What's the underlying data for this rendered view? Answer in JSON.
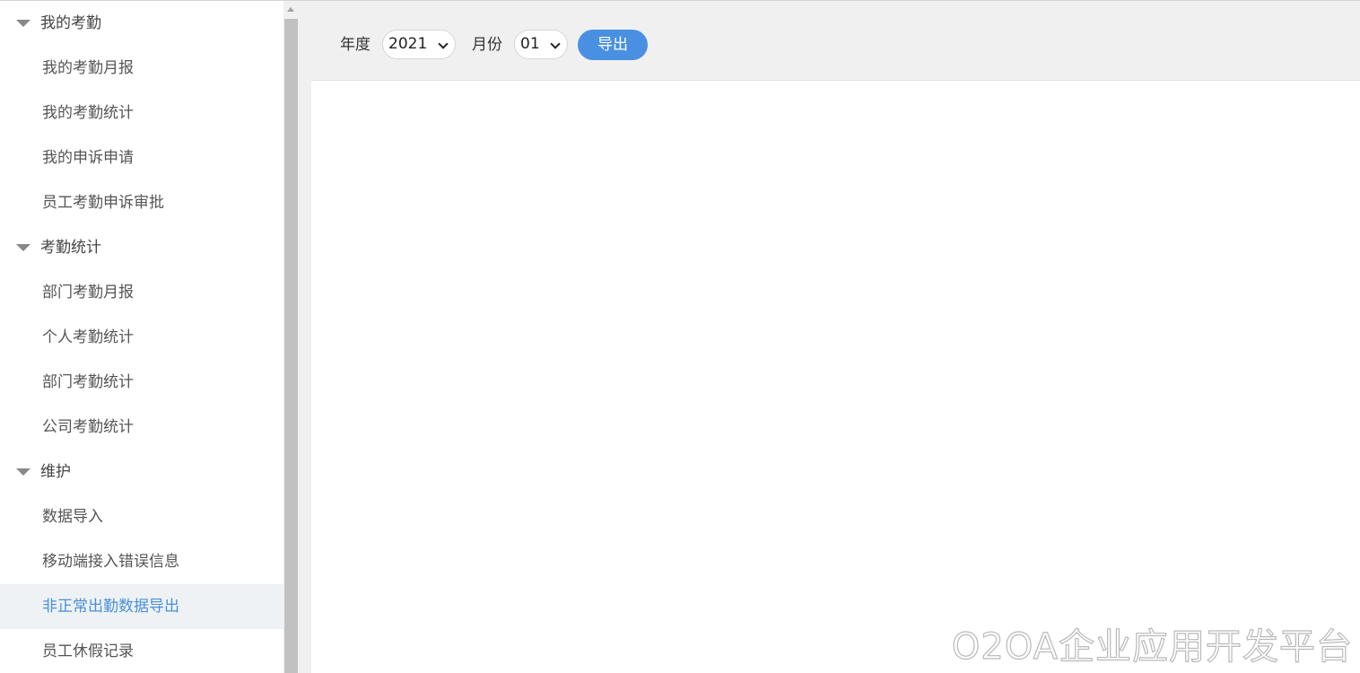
{
  "sidebar": {
    "groups": [
      {
        "title": "我的考勤",
        "items": [
          "我的考勤月报",
          "我的考勤统计",
          "我的申诉申请",
          "员工考勤申诉审批"
        ]
      },
      {
        "title": "考勤统计",
        "items": [
          "部门考勤月报",
          "个人考勤统计",
          "部门考勤统计",
          "公司考勤统计"
        ]
      },
      {
        "title": "维护",
        "items": [
          "数据导入",
          "移动端接入错误信息",
          "非正常出勤数据导出",
          "员工休假记录"
        ]
      }
    ],
    "active_item": "非正常出勤数据导出"
  },
  "toolbar": {
    "year_label": "年度",
    "year_value": "2021",
    "month_label": "月份",
    "month_value": "01",
    "export_label": "导出"
  },
  "watermark": "O2OA企业应用开发平台",
  "colors": {
    "accent": "#4a90e2",
    "active_text": "#4a90d9",
    "active_bg": "#eef2f5",
    "toolbar_bg": "#f0f0f0"
  }
}
